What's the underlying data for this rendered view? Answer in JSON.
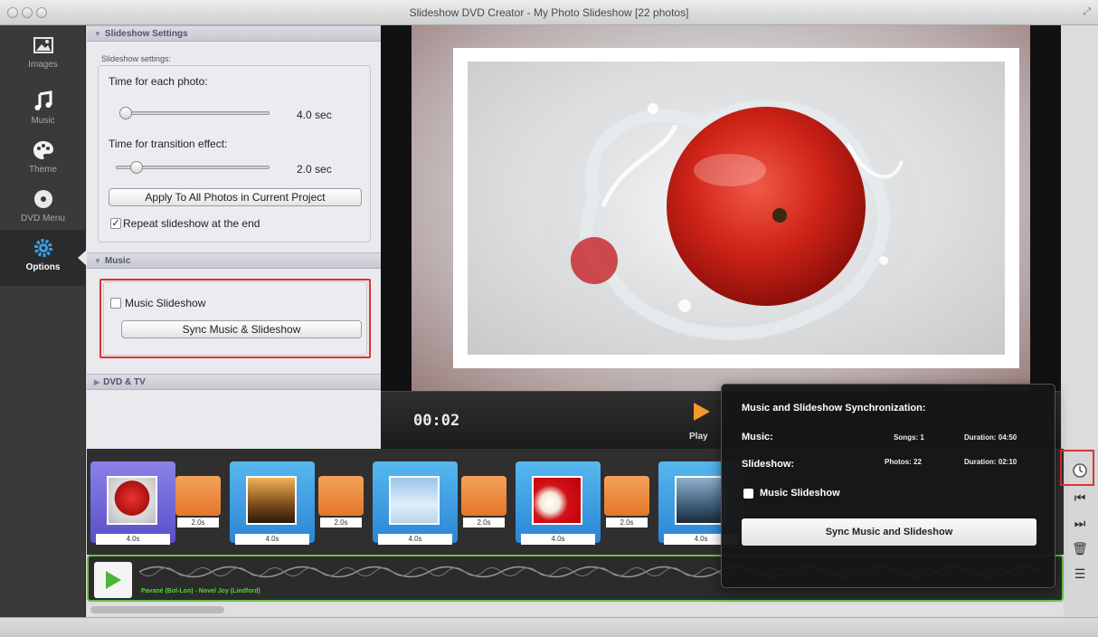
{
  "window": {
    "title": "Slideshow DVD Creator - My Photo Slideshow [22 photos]"
  },
  "nav": {
    "items": [
      {
        "label": "Images",
        "icon": "image-icon"
      },
      {
        "label": "Music",
        "icon": "music-note-icon"
      },
      {
        "label": "Theme",
        "icon": "palette-icon"
      },
      {
        "label": "DVD Menu",
        "icon": "disc-icon"
      },
      {
        "label": "Options",
        "icon": "gear-icon",
        "active": true
      }
    ]
  },
  "settings": {
    "section_title": "Slideshow Settings",
    "group_label": "Slideshow settings:",
    "photo_time_label": "Time for each photo:",
    "photo_time_value": "4.0 sec",
    "transition_label": "Time for transition effect:",
    "transition_value": "2.0 sec",
    "apply_button": "Apply To All Photos in Current Project",
    "repeat_label": "Repeat slideshow at the end",
    "repeat_checked": true
  },
  "music_section": {
    "title": "Music",
    "checkbox_label": "Music Slideshow",
    "sync_button": "Sync Music & Slideshow"
  },
  "dvd_section": {
    "title": "DVD & TV"
  },
  "player": {
    "timecode": "00:02",
    "play_label": "Play"
  },
  "timeline": {
    "photos": [
      {
        "duration": "4.0s",
        "selected": true
      },
      {
        "duration": "4.0s"
      },
      {
        "duration": "4.0s"
      },
      {
        "duration": "4.0s"
      },
      {
        "duration": "4.0s"
      }
    ],
    "transitions": [
      {
        "duration": "2.0s"
      },
      {
        "duration": "2.0s"
      },
      {
        "duration": "2.0s"
      },
      {
        "duration": "2.0s"
      }
    ],
    "audio_track_name": "Pavané (Bol-Lon) - Novel Joy (Lindford)"
  },
  "sync_popover": {
    "title": "Music and Slideshow Synchronization:",
    "music_label": "Music:",
    "songs": "Songs: 1",
    "music_duration": "Duration: 04:50",
    "slideshow_label": "Slideshow:",
    "photos": "Photos: 22",
    "slideshow_duration": "Duration: 02:10",
    "checkbox_label": "Music Slideshow",
    "button_label": "Sync Music and Slideshow"
  },
  "colors": {
    "accent_blue": "#3aa0e8",
    "highlight_red": "#dd3333",
    "play_orange": "#f39a2a",
    "audio_green": "#6bc24a"
  }
}
